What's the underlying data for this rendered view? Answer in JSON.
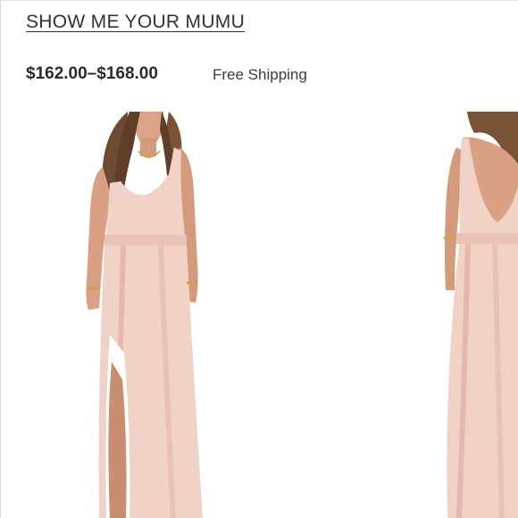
{
  "listing": {
    "brand": "SHOW ME YOUR MUMU",
    "price_range": "$162.00–$168.00",
    "shipping": "Free Shipping"
  },
  "gallery": {
    "images": [
      {
        "name": "front view"
      },
      {
        "name": "back view"
      }
    ]
  },
  "colors": {
    "dress": "#f1d2c6",
    "dress_shadow": "#e2b9ab",
    "skin": "#d9a084",
    "hair": "#6e4a32",
    "text": "#2b2b2b"
  }
}
